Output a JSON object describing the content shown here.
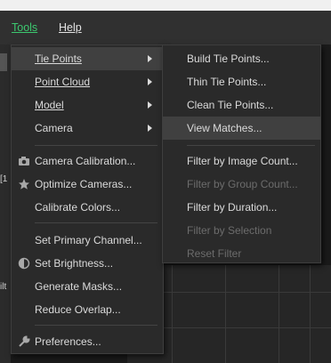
{
  "menubar": {
    "tools": "Tools",
    "help": "Help"
  },
  "background": {
    "left_text_1": "[1",
    "left_text_2": "ilt"
  },
  "tools_menu": {
    "items": [
      {
        "label": "Tie Points",
        "icon": null,
        "submenu": true
      },
      {
        "label": "Point Cloud",
        "icon": null,
        "submenu": true
      },
      {
        "label": "Model",
        "icon": null,
        "submenu": true
      },
      {
        "label": "Camera",
        "icon": null,
        "submenu": true
      },
      {
        "label": "Camera Calibration...",
        "icon": "camera-icon"
      },
      {
        "label": "Optimize Cameras...",
        "icon": "star-icon"
      },
      {
        "label": "Calibrate Colors..."
      },
      {
        "label": "Set Primary Channel..."
      },
      {
        "label": "Set Brightness...",
        "icon": "brightness-icon"
      },
      {
        "label": "Generate Masks..."
      },
      {
        "label": "Reduce Overlap..."
      },
      {
        "label": "Preferences...",
        "icon": "wrench-icon"
      }
    ]
  },
  "tie_points_submenu": {
    "items": [
      {
        "label": "Build Tie Points..."
      },
      {
        "label": "Thin Tie Points..."
      },
      {
        "label": "Clean Tie Points..."
      },
      {
        "label": "View Matches..."
      },
      {
        "label": "Filter by Image Count..."
      },
      {
        "label": "Filter by Group Count...",
        "disabled": true
      },
      {
        "label": "Filter by Duration..."
      },
      {
        "label": "Filter by Selection",
        "disabled": true
      },
      {
        "label": "Reset Filter",
        "disabled": true
      }
    ]
  },
  "colors": {
    "accent": "#3cc86f",
    "menu_bg": "#2a2a2a",
    "highlight": "#404040",
    "disabled_text": "#6c6c6c"
  }
}
